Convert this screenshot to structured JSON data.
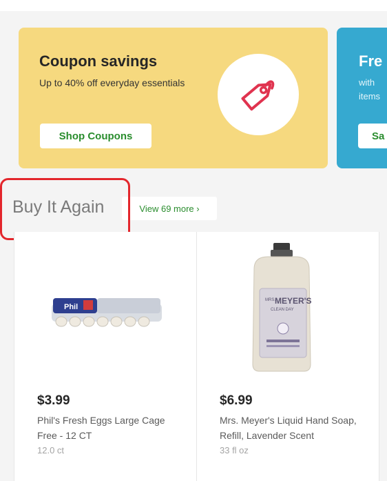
{
  "promos": {
    "coupons": {
      "title": "Coupon savings",
      "subtitle": "Up to 40% off everyday essentials",
      "button": "Shop Coupons",
      "icon": "tag-icon"
    },
    "fresh": {
      "title": "Fre",
      "subtitle_line1": "with",
      "subtitle_line2": "items",
      "button": "Sa"
    }
  },
  "buy_it_again": {
    "title": "Buy It Again",
    "view_more": "View 69 more ›"
  },
  "products": [
    {
      "price": "$3.99",
      "name": "Phil's Fresh Eggs Large Cage Free - 12 CT",
      "size": "12.0 ct"
    },
    {
      "price": "$6.99",
      "name": "Mrs. Meyer's Liquid Hand Soap, Refill, Lavender Scent",
      "size": "33 fl oz",
      "label_brand": "MEYER'S",
      "label_sub": "CLEAN DAY"
    }
  ],
  "colors": {
    "coupon_bg": "#f6d97f",
    "fresh_bg": "#36a9d0",
    "accent_green": "#2a8d2e",
    "highlight_red": "#e3262c",
    "tag_pink": "#e0334f"
  }
}
